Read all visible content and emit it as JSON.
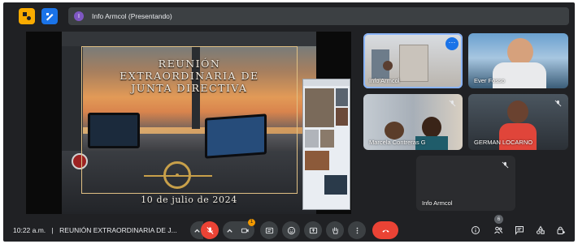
{
  "presenting_banner": {
    "avatar_letter": "I",
    "text": "Info Armcol (Presentando)"
  },
  "slide": {
    "title_line1": "REUNIÓN",
    "title_line2": "EXTRAORDINARIA DE",
    "title_line3": "JUNTA DIRECTIVA",
    "date": "10 de julio de 2024"
  },
  "participants": [
    {
      "name": "Info Armcol",
      "active_speaker": true
    },
    {
      "name": "Ever Fosso"
    },
    {
      "name": "Marcela Contreras G"
    },
    {
      "name": "GERMAN LOCARNO"
    },
    {
      "name": "Info Armcol"
    }
  ],
  "bottom_bar": {
    "time": "10:22 a.m.",
    "separator": "|",
    "meeting_title": "REUNIÓN EXTRAORDINARIA DE J...",
    "notification_count": "1",
    "participant_count": "6"
  },
  "colors": {
    "background": "#202124",
    "tile": "#3c4043",
    "accent_blue": "#1a73e8",
    "end_call_red": "#ea4335",
    "notice_yellow": "#f9ab00"
  }
}
